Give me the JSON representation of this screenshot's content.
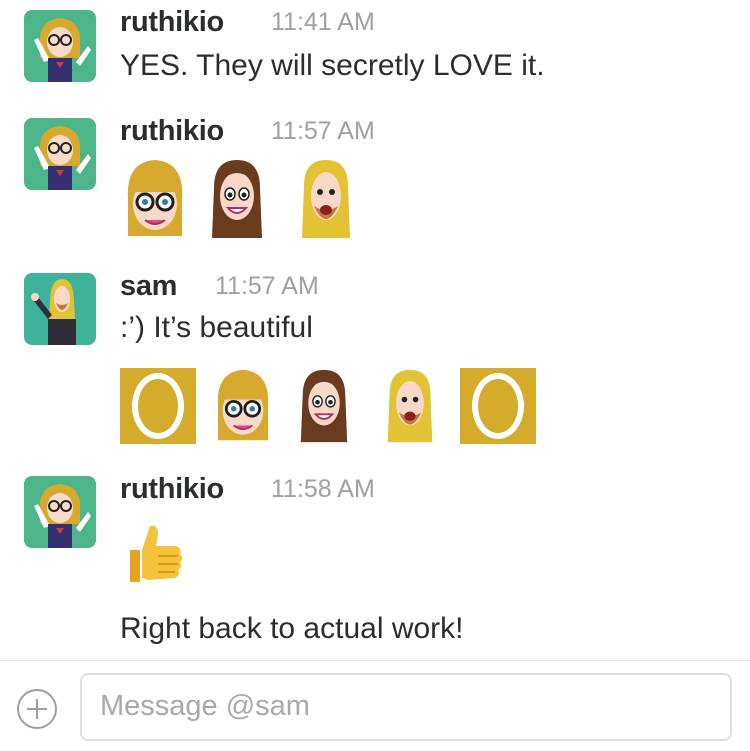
{
  "messages": [
    {
      "author": "ruthikio",
      "time": "11:41 AM",
      "text": "YES. They will secretly LOVE it."
    },
    {
      "author": "ruthikio",
      "time": "11:57 AM"
    },
    {
      "author": "sam",
      "time": "11:57 AM",
      "text": ":’) It’s beautiful"
    },
    {
      "author": "ruthikio",
      "time": "11:58 AM",
      "text": "Right back to actual work!"
    }
  ],
  "composer": {
    "placeholder": "Message @sam"
  }
}
